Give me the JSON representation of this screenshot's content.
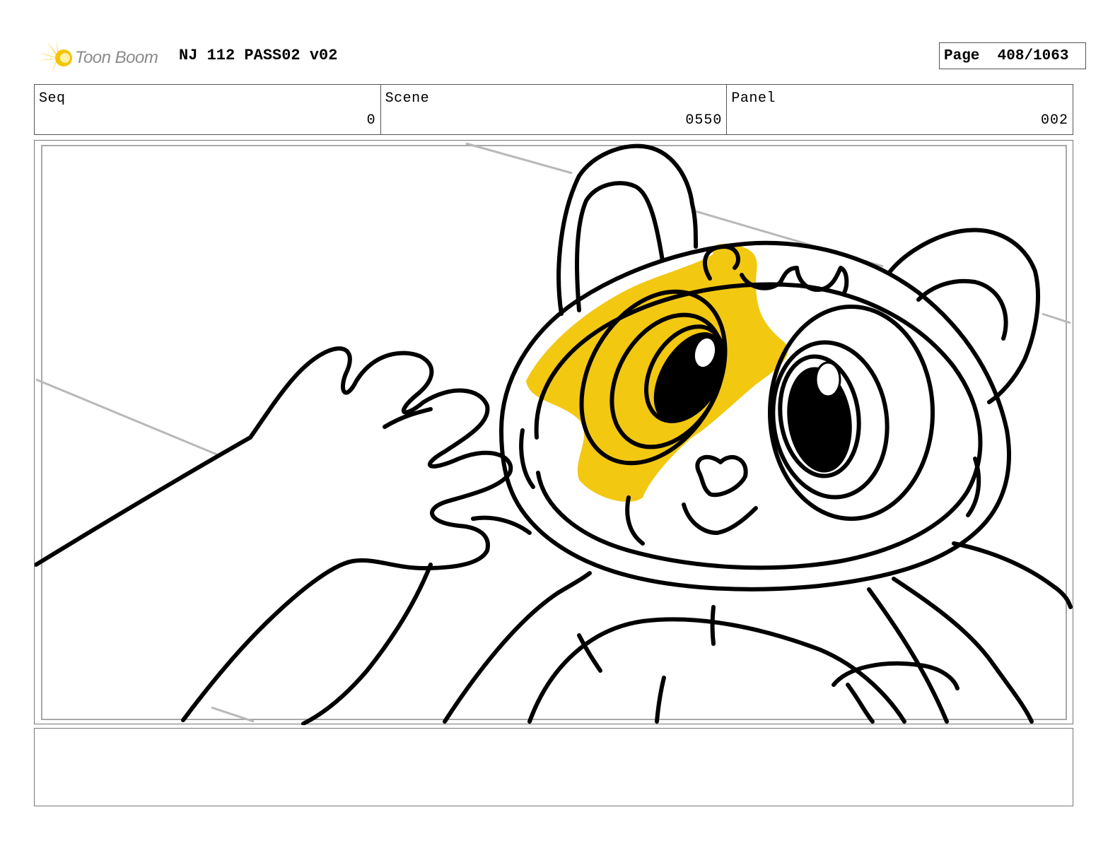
{
  "header": {
    "logo_text": "Toon Boom",
    "logo_icon": "starburst-logo-icon",
    "title": "NJ 112 PASS02 v02",
    "page_label": "Page",
    "page_value": "408/1063"
  },
  "fields": {
    "seq": {
      "label": "Seq",
      "value": "0"
    },
    "scene": {
      "label": "Scene",
      "value": "0550"
    },
    "panel": {
      "label": "Panel",
      "value": "002"
    }
  },
  "colors": {
    "accent_yellow": "#f2c811",
    "line": "#000000",
    "guide_gray": "#b8b8b8",
    "border": "#555555"
  },
  "drawing": {
    "subject": "storyboard-sketch-raccoon-character-icon"
  },
  "caption": {
    "text": ""
  }
}
